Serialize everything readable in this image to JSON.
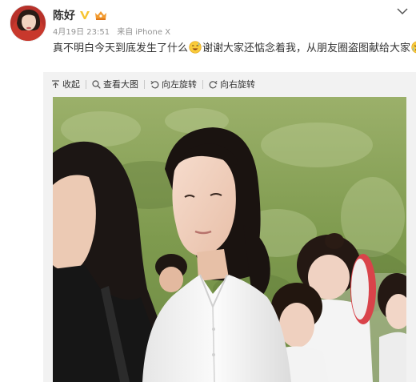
{
  "post": {
    "author_name": "陈好",
    "verified_icon": "verified-v-icon",
    "vip_icon": "vip-crown-icon",
    "date": "4月19日 23:51",
    "source_prefix": "来自",
    "source_device": "iPhone X",
    "text_part1": "真不明白今天到底发生了什么",
    "text_part2": "谢谢大家还惦念着我，从朋友圈盗图献给大家",
    "emoji_1": "sweat-smile-emoji",
    "emoji_2": "tears-emoji"
  },
  "toolbar": {
    "collapse_label": "收起",
    "view_large_label": "查看大图",
    "rotate_left_label": "向左旋转",
    "rotate_right_label": "向右旋转"
  },
  "colors": {
    "text_primary": "#333333",
    "text_meta": "#939393",
    "verified": "#f7c431",
    "panel_bg": "#f2f2f2"
  }
}
